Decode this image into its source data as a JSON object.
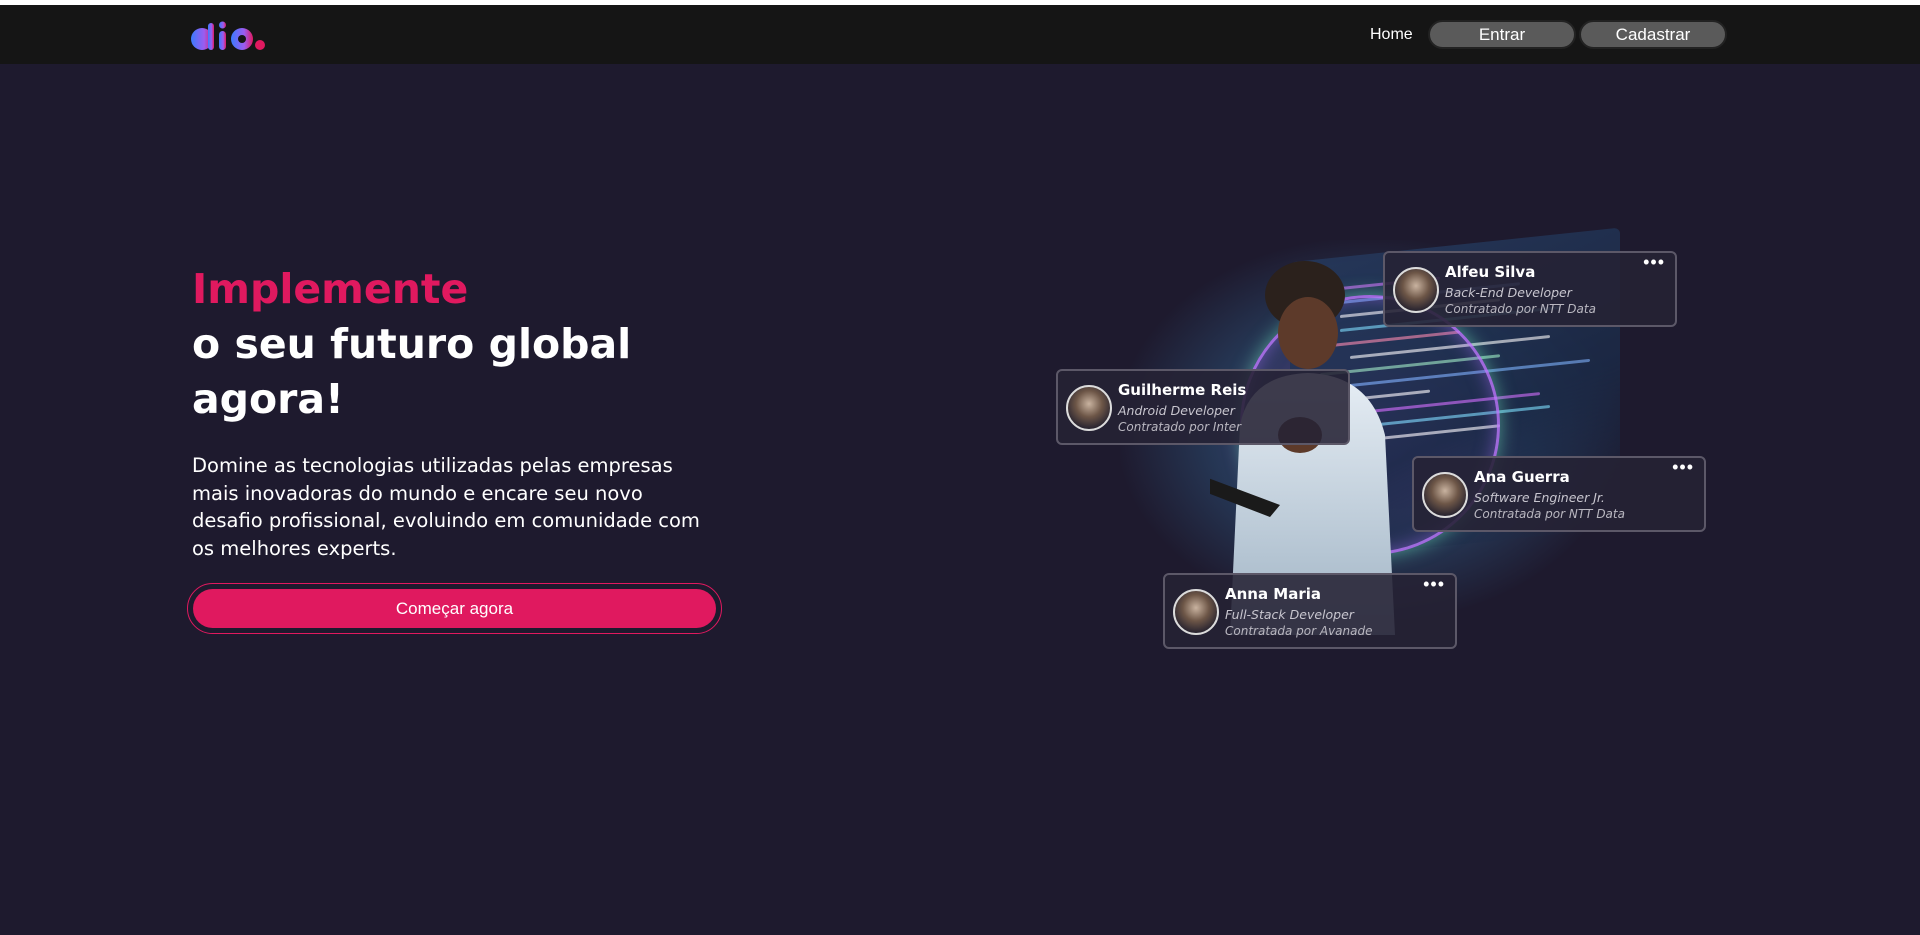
{
  "nav": {
    "home_label": "Home",
    "login_label": "Entrar",
    "signup_label": "Cadastrar"
  },
  "hero": {
    "title_accent": "Implemente",
    "title_line2": "o seu futuro global",
    "title_line3": "agora!",
    "description": "Domine as tecnologias utilizadas pelas empresas mais inovadoras do mundo e encare seu novo desafio profissional, evoluindo em comunidade com os melhores experts.",
    "cta_label": "Começar agora"
  },
  "cards": [
    {
      "name": "Alfeu Silva",
      "role": "Back-End Developer",
      "company": "Contratado por NTT Data"
    },
    {
      "name": "Guilherme Reis",
      "role": "Android Developer",
      "company": "Contratado por Inter"
    },
    {
      "name": "Ana Guerra",
      "role": "Software Engineer Jr.",
      "company": "Contratada por NTT Data"
    },
    {
      "name": "Anna Maria",
      "role": "Full-Stack Developer",
      "company": "Contratada por Avanade"
    }
  ],
  "colors": {
    "background": "#1e1a2e",
    "navbar": "#151515",
    "accent": "#e0195f",
    "nav_button": "#5a5a5a"
  },
  "icons": {
    "logo": "dio-logo",
    "card_menu": "more-dots-icon"
  }
}
